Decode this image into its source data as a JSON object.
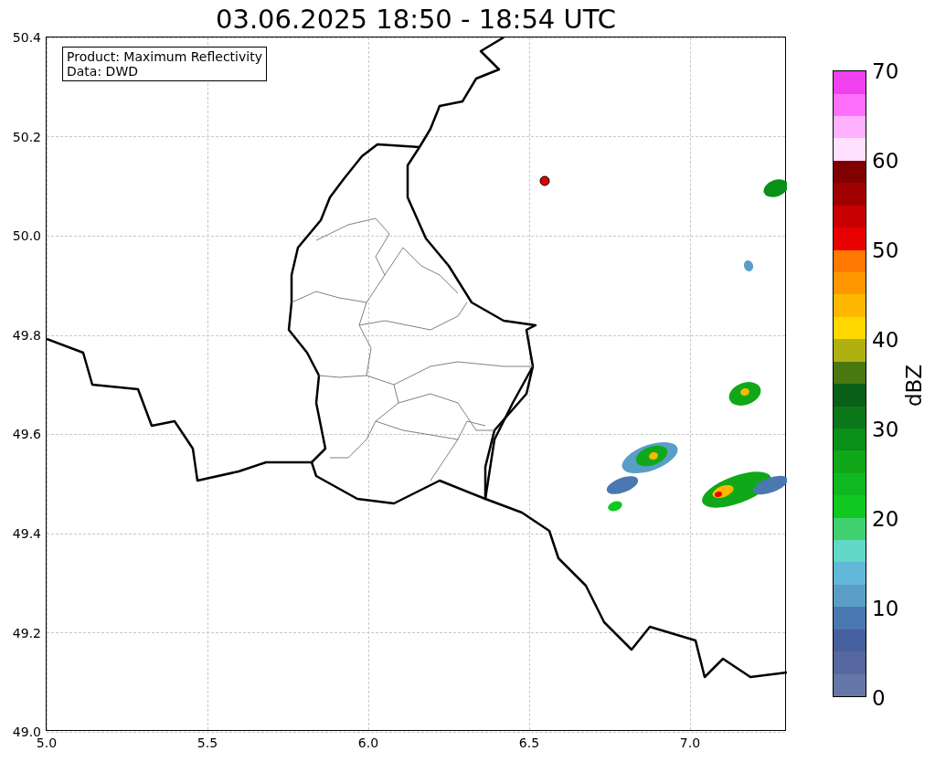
{
  "title": "03.06.2025 18:50 - 18:54 UTC",
  "legend": {
    "lines": [
      "Product: Maximum Reflectivity",
      "Data: DWD"
    ]
  },
  "x_ticks": [
    "5.0",
    "5.5",
    "6.0",
    "6.5",
    "7.0"
  ],
  "y_ticks": [
    "50.4",
    "50.2",
    "50.0",
    "49.8",
    "49.6",
    "49.4",
    "49.2",
    "49.0"
  ],
  "colorbar": {
    "label": "dBZ",
    "ticks": [
      "70",
      "60",
      "50",
      "40",
      "30",
      "20",
      "10",
      "0"
    ],
    "segments": [
      {
        "color": "#6577a8"
      },
      {
        "color": "#5768a0"
      },
      {
        "color": "#4760a0"
      },
      {
        "color": "#4a78b0"
      },
      {
        "color": "#5a9ec8"
      },
      {
        "color": "#62b8d8"
      },
      {
        "color": "#62d8c8"
      },
      {
        "color": "#40d070"
      },
      {
        "color": "#10c820"
      },
      {
        "color": "#10b820"
      },
      {
        "color": "#10a818"
      },
      {
        "color": "#0a9018"
      },
      {
        "color": "#0a7818"
      },
      {
        "color": "#0a6018"
      },
      {
        "color": "#4a7810"
      },
      {
        "color": "#b0b010"
      },
      {
        "color": "#ffd800"
      },
      {
        "color": "#ffb800"
      },
      {
        "color": "#ff9800"
      },
      {
        "color": "#ff7800"
      },
      {
        "color": "#e80000"
      },
      {
        "color": "#c80000"
      },
      {
        "color": "#a00000"
      },
      {
        "color": "#800000"
      },
      {
        "color": "#ffe0ff"
      },
      {
        "color": "#ffb0ff"
      },
      {
        "color": "#ff70ff"
      },
      {
        "color": "#f040f0"
      }
    ]
  }
}
